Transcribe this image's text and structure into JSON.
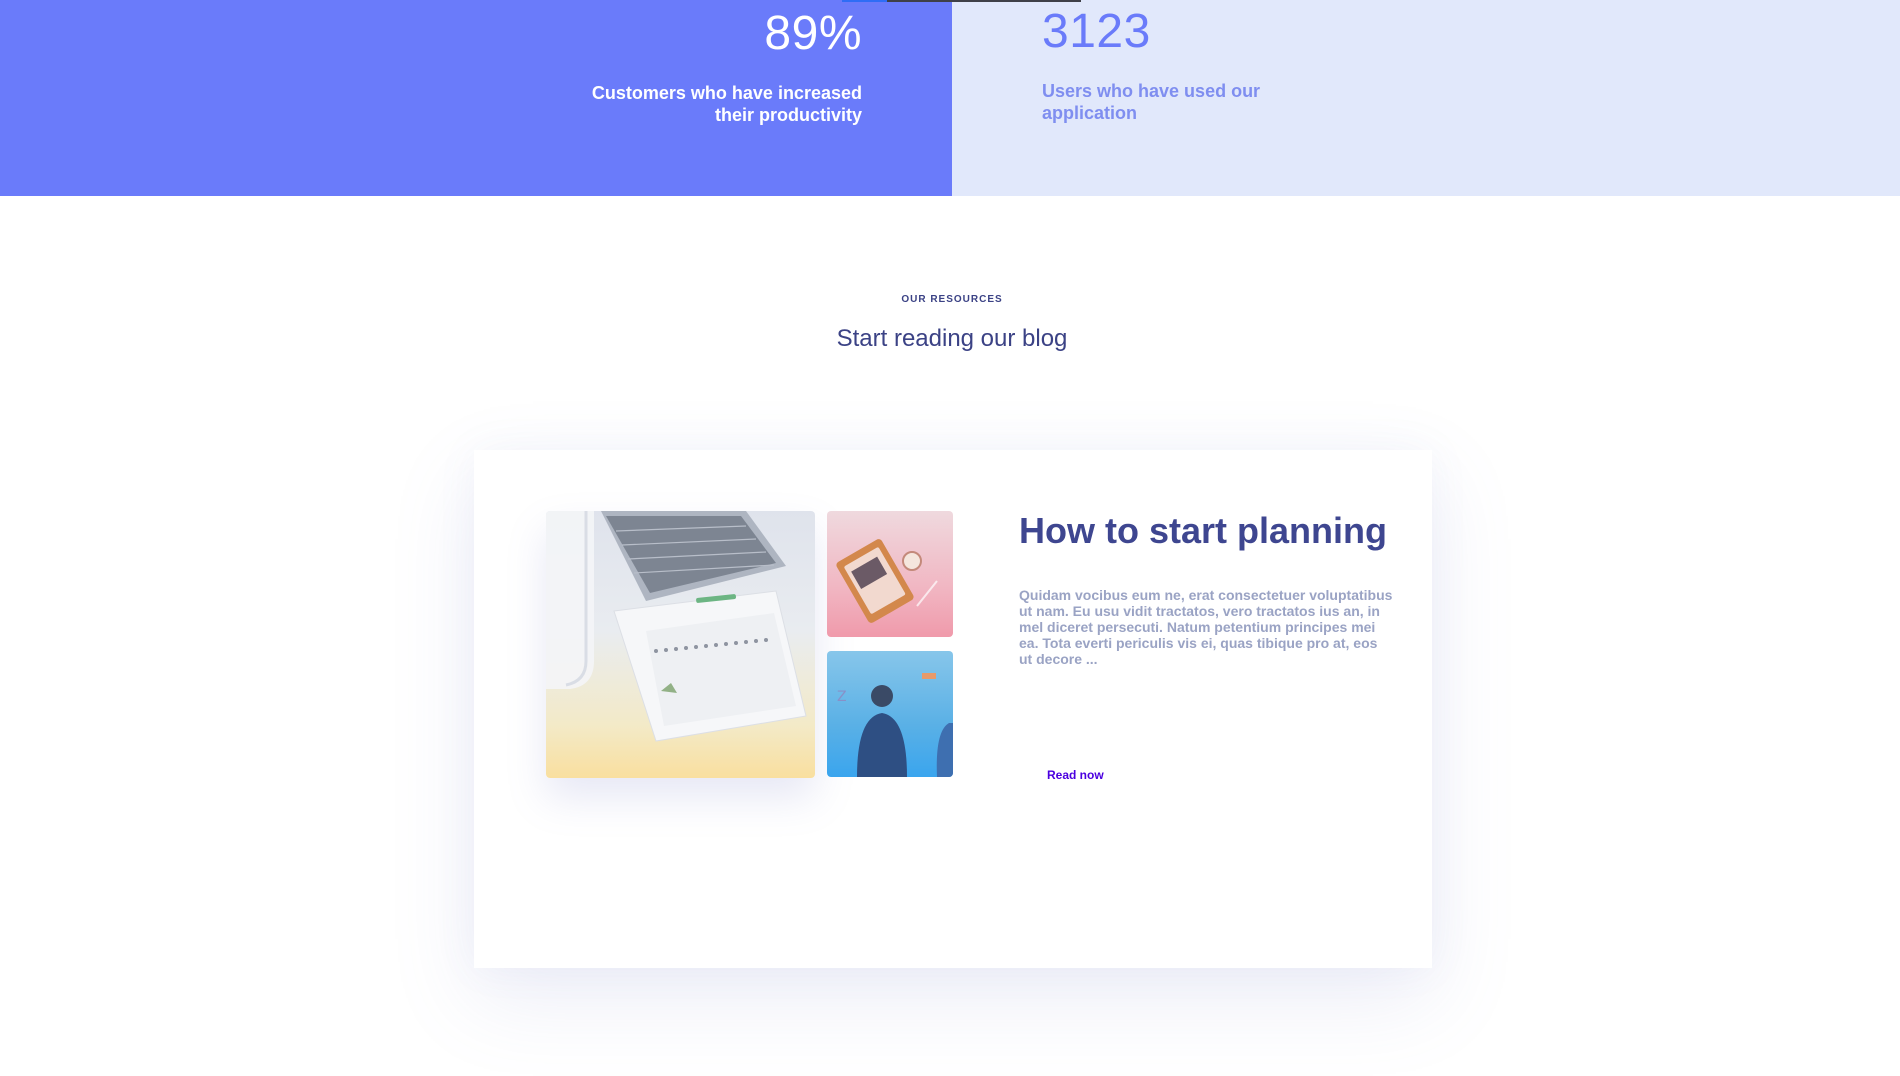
{
  "stats": {
    "progress_fraction": 0.19,
    "left": {
      "value": "89%",
      "caption": "Customers who have increased their productivity"
    },
    "right": {
      "value": "3123",
      "caption": "Users who have used our application"
    }
  },
  "resources": {
    "eyebrow": "OUR RESOURCES",
    "title": "Start reading our blog"
  },
  "blog_post": {
    "title": "How to start planning",
    "excerpt": "Quidam vocibus eum ne, erat consectetuer voluptatibus ut nam. Eu usu vidit tractatos, vero tractatos ius an, in mel diceret persecuti. Natum petentium principes mei ea. Tota everti periculis vis ei, quas tibique pro at, eos ut decore ...",
    "read_label": "Read now"
  },
  "colors": {
    "primary": "#6a7bfa",
    "light_bg": "#e1e8fb",
    "heading": "#3e4690",
    "link": "#4b00e0"
  }
}
